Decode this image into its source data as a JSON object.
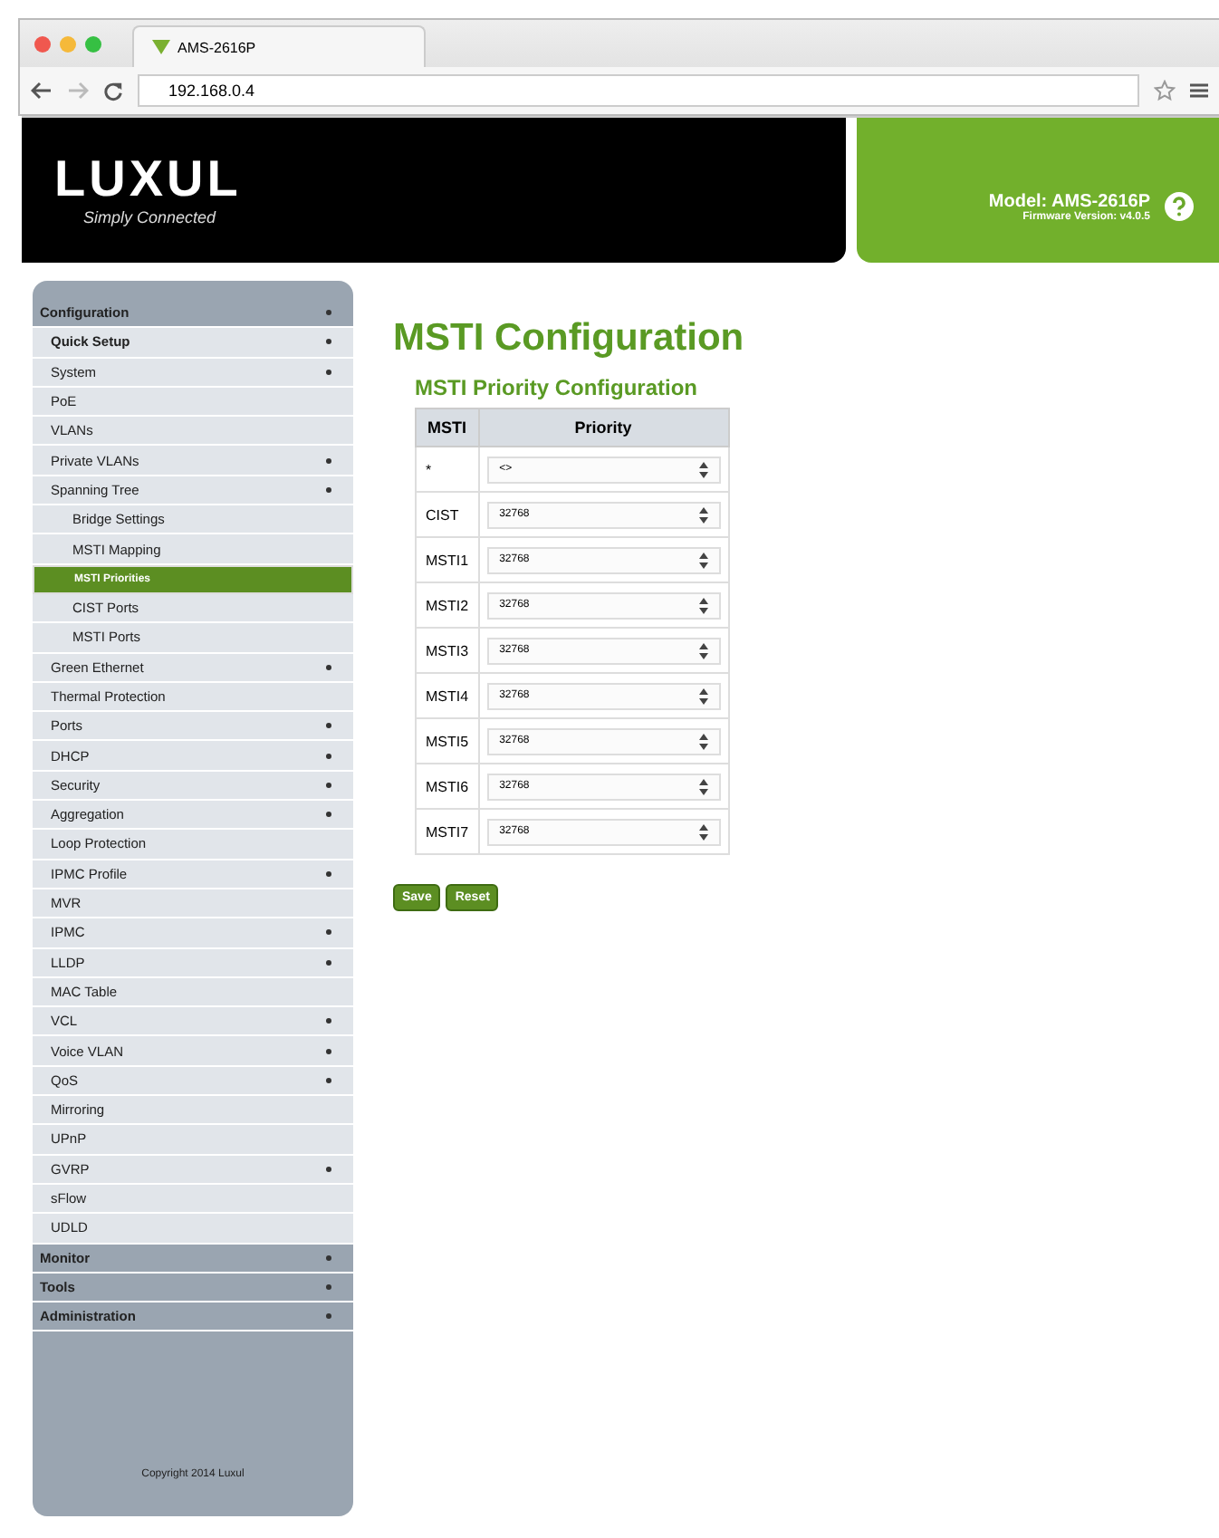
{
  "browser": {
    "tab_title": "AMS-2616P",
    "address": "192.168.0.4"
  },
  "header": {
    "logo": "LUXUL",
    "tagline": "Simply Connected",
    "model": "Model: AMS-2616P",
    "firmware": "Firmware Version: v4.0.5"
  },
  "sidebar": {
    "items": [
      {
        "label": "Configuration",
        "expandable": true,
        "selected": false,
        "children": [
          {
            "label": "Quick Setup",
            "expandable": true,
            "selected": false
          },
          {
            "label": "System",
            "expandable": true,
            "selected": false
          },
          {
            "label": "PoE",
            "expandable": false,
            "selected": false
          },
          {
            "label": "VLANs",
            "expandable": false,
            "selected": false
          },
          {
            "label": "Private VLANs",
            "expandable": true,
            "selected": false
          },
          {
            "label": "Spanning Tree",
            "expandable": true,
            "selected": false,
            "children": [
              {
                "label": "Bridge Settings",
                "expandable": false,
                "selected": false
              },
              {
                "label": "MSTI Mapping",
                "expandable": false,
                "selected": false
              },
              {
                "label": "MSTI Priorities",
                "expandable": false,
                "selected": true
              },
              {
                "label": "CIST Ports",
                "expandable": false,
                "selected": false
              },
              {
                "label": "MSTI Ports",
                "expandable": false,
                "selected": false
              }
            ]
          },
          {
            "label": "Green Ethernet",
            "expandable": true,
            "selected": false
          },
          {
            "label": "Thermal Protection",
            "expandable": false,
            "selected": false
          },
          {
            "label": "Ports",
            "expandable": true,
            "selected": false
          },
          {
            "label": "DHCP",
            "expandable": true,
            "selected": false
          },
          {
            "label": "Security",
            "expandable": true,
            "selected": false
          },
          {
            "label": "Aggregation",
            "expandable": true,
            "selected": false
          },
          {
            "label": "Loop Protection",
            "expandable": false,
            "selected": false
          },
          {
            "label": "IPMC Profile",
            "expandable": true,
            "selected": false
          },
          {
            "label": "MVR",
            "expandable": false,
            "selected": false
          },
          {
            "label": "IPMC",
            "expandable": true,
            "selected": false
          },
          {
            "label": "LLDP",
            "expandable": true,
            "selected": false
          },
          {
            "label": "MAC Table",
            "expandable": false,
            "selected": false
          },
          {
            "label": "VCL",
            "expandable": true,
            "selected": false
          },
          {
            "label": "Voice VLAN",
            "expandable": true,
            "selected": false
          },
          {
            "label": "QoS",
            "expandable": true,
            "selected": false
          },
          {
            "label": "Mirroring",
            "expandable": false,
            "selected": false
          },
          {
            "label": "UPnP",
            "expandable": false,
            "selected": false
          },
          {
            "label": "GVRP",
            "expandable": true,
            "selected": false
          },
          {
            "label": "sFlow",
            "expandable": false,
            "selected": false
          },
          {
            "label": "UDLD",
            "expandable": false,
            "selected": false
          }
        ]
      },
      {
        "label": "Monitor",
        "expandable": true,
        "selected": false
      },
      {
        "label": "Tools",
        "expandable": true,
        "selected": false
      },
      {
        "label": "Administration",
        "expandable": true,
        "selected": false
      }
    ],
    "copyright": "Copyright 2014 Luxul"
  },
  "page": {
    "title": "MSTI Configuration",
    "section_title": "MSTI Priority Configuration",
    "table": {
      "columns": [
        "MSTI",
        "Priority"
      ],
      "rows": [
        {
          "msti": "*",
          "priority": "<>"
        },
        {
          "msti": "CIST",
          "priority": "32768"
        },
        {
          "msti": "MSTI1",
          "priority": "32768"
        },
        {
          "msti": "MSTI2",
          "priority": "32768"
        },
        {
          "msti": "MSTI3",
          "priority": "32768"
        },
        {
          "msti": "MSTI4",
          "priority": "32768"
        },
        {
          "msti": "MSTI5",
          "priority": "32768"
        },
        {
          "msti": "MSTI6",
          "priority": "32768"
        },
        {
          "msti": "MSTI7",
          "priority": "32768"
        }
      ]
    },
    "buttons": [
      "Save",
      "Reset"
    ]
  }
}
